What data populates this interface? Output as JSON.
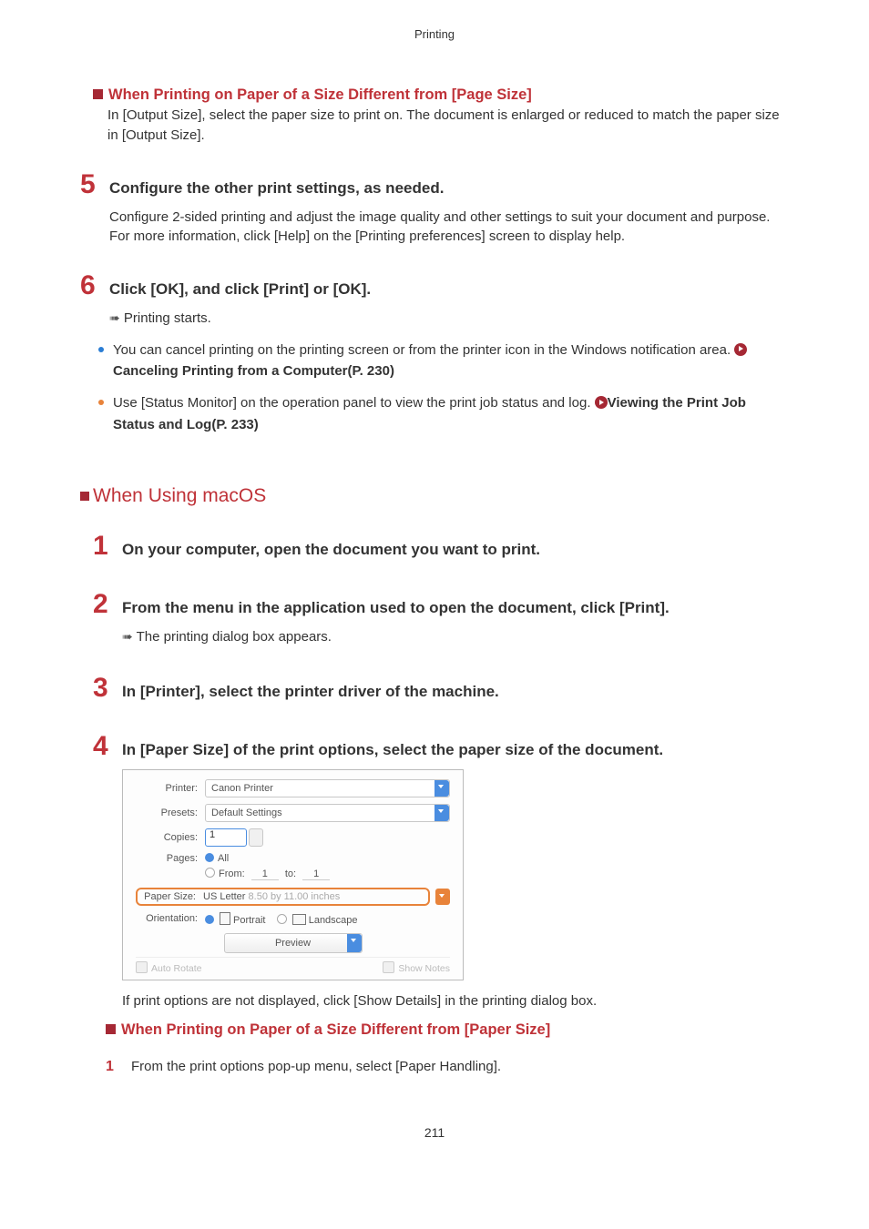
{
  "header": "Printing",
  "subheading1": "When Printing on Paper of a Size Different from [Page Size]",
  "subheading1_body": "In [Output Size], select the paper size to print on. The document is enlarged or reduced to match the paper size in [Output Size].",
  "step5": {
    "num": "5",
    "title": "Configure the other print settings, as needed.",
    "body": "Configure 2-sided printing and adjust the image quality and other settings to suit your document and purpose. For more information, click [Help] on the [Printing preferences] screen to display help."
  },
  "step6": {
    "num": "6",
    "title": "Click [OK], and click [Print] or [OK].",
    "arrow_text": "Printing starts.",
    "bullet1_a": "You can cancel printing on the printing screen or from the printer icon in the Windows notification area. ",
    "bullet1_link": "Canceling Printing from a Computer(P. 230)",
    "bullet2_a": "Use [Status Monitor] on the operation panel to view the print job status and log. ",
    "bullet2_link": "Viewing the Print Job Status and Log(P. 233)"
  },
  "macos_heading": "When Using macOS",
  "m_step1": {
    "num": "1",
    "title": "On your computer, open the document you want to print."
  },
  "m_step2": {
    "num": "2",
    "title": "From the menu in the application used to open the document, click [Print].",
    "arrow_text": "The printing dialog box appears."
  },
  "m_step3": {
    "num": "3",
    "title": "In [Printer], select the printer driver of the machine."
  },
  "m_step4": {
    "num": "4",
    "title": "In [Paper Size] of the print options, select the paper size of the document."
  },
  "dialog": {
    "printer_label": "Printer:",
    "printer_val": "Canon Printer",
    "presets_label": "Presets:",
    "presets_val": "Default Settings",
    "copies_label": "Copies:",
    "copies_val": "1",
    "pages_label": "Pages:",
    "all": "All",
    "from": "From:",
    "from_val": "1",
    "to": "to:",
    "to_val": "1",
    "psize_label": "Paper Size:",
    "psize_val": "US Letter",
    "psize_dim": "8.50 by 11.00 inches",
    "orient_label": "Orientation:",
    "portrait": "Portrait",
    "landscape": "Landscape",
    "preview": "Preview",
    "auto_rotate": "Auto Rotate",
    "show_notes": "Show Notes"
  },
  "after_img": "If print options are not displayed, click [Show Details] in the printing dialog box.",
  "subheading2": "When Printing on Paper of a Size Different from [Paper Size]",
  "substep1": {
    "num": "1",
    "text": "From the print options pop-up menu, select [Paper Handling]."
  },
  "page_num": "211"
}
